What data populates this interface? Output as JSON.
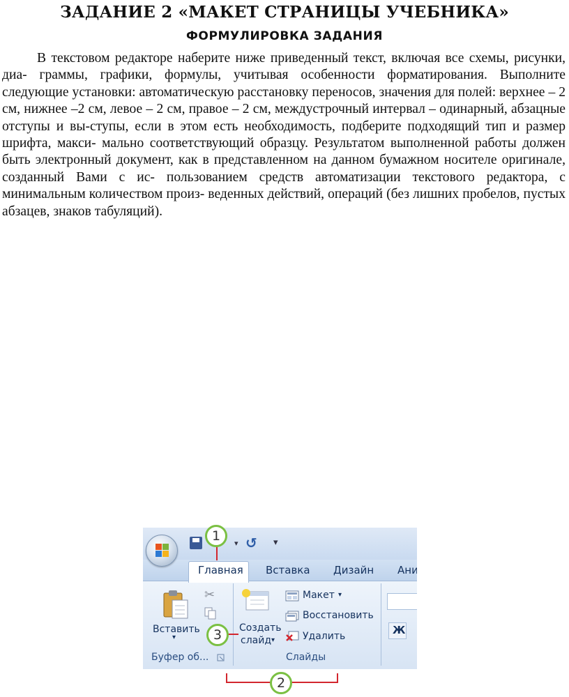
{
  "title": "ЗАДАНИЕ 2 «МАКЕТ СТРАНИЦЫ УЧЕБНИКА»",
  "subtitle": "ФОРМУЛИРОВКА  ЗАДАНИЯ",
  "body": "В текстовом редакторе наберите ниже приведенный текст, включая все схемы, рисунки, диа- граммы, графики, формулы, учитывая особенности форматирования. Выполните следующие установки: автоматическую расстановку переносов, значения для полей: верхнее – 2 см, нижнее –2 см, левое – 2 см, правое – 2 см, междустрочный интервал – одинарный, абзацные отступы и вы-ступы, если в этом есть необходимость, подберите подходящий тип и размер шрифта, макси- мально соответствующий образцу. Результатом выполненной работы должен быть электронный документ, как в представленном на данном бумажном носителе оригинале, созданный Вами с ис- пользованием средств автоматизации текстового редактора, с минимальным количеством произ- веденных действий, операций (без лишних пробелов, пустых абзацев, знаков табуляций).",
  "ribbon": {
    "tabs": [
      "Главная",
      "Вставка",
      "Дизайн",
      "Ани"
    ],
    "paste_label": "Вставить",
    "clipboard_group": "Буфер об...",
    "new_slide_line1": "Создать",
    "new_slide_line2": "слайд",
    "layout_label": "Макет",
    "reset_label": "Восстановить",
    "delete_label": "Удалить",
    "slides_group": "Слайды",
    "bold_label": "Ж"
  },
  "callouts": [
    "1",
    "2",
    "3"
  ],
  "colors": {
    "callout_ring": "#7bc043",
    "callout_line": "#d3262e",
    "tab_text": "#15325e"
  }
}
